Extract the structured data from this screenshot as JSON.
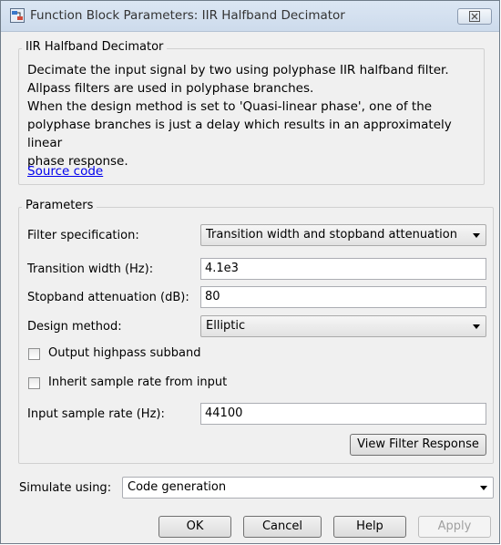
{
  "window": {
    "title": "Function Block Parameters: IIR Halfband Decimator",
    "close_label": "☒"
  },
  "description_group": {
    "title": "IIR Halfband Decimator",
    "lines": [
      "Decimate the input signal by two using polyphase IIR halfband filter.",
      "Allpass filters are used in polyphase branches.",
      "When the design method is set to 'Quasi-linear phase', one of the",
      "polyphase branches is just a delay which results in an approximately linear",
      "phase response."
    ],
    "link": "Source code"
  },
  "parameters": {
    "title": "Parameters",
    "filter_spec": {
      "label": "Filter specification:",
      "value": "Transition width and stopband attenuation"
    },
    "transition_width": {
      "label": "Transition width (Hz):",
      "value": "4.1e3"
    },
    "stopband_atten": {
      "label": "Stopband attenuation (dB):",
      "value": "80"
    },
    "design_method": {
      "label": "Design method:",
      "value": "Elliptic"
    },
    "output_highpass": {
      "label": "Output highpass subband",
      "checked": false
    },
    "inherit_rate": {
      "label": "Inherit sample rate from input",
      "checked": false
    },
    "input_rate": {
      "label": "Input sample rate (Hz):",
      "value": "44100"
    },
    "view_response_label": "View Filter Response"
  },
  "simulate": {
    "label": "Simulate using:",
    "value": "Code generation"
  },
  "buttons": {
    "ok": "OK",
    "cancel": "Cancel",
    "help": "Help",
    "apply": "Apply"
  }
}
